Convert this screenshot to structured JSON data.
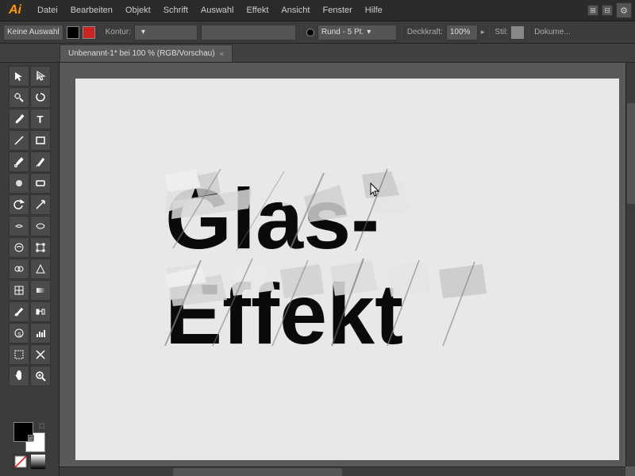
{
  "app": {
    "logo": "Ai",
    "logo_color": "#ff9900"
  },
  "menu": {
    "items": [
      "Datei",
      "Bearbeiten",
      "Objekt",
      "Schrift",
      "Auswahl",
      "Effekt",
      "Ansicht",
      "Fenster",
      "Hilfe"
    ]
  },
  "toolbar": {
    "selection_label": "Keine Auswahl",
    "kontur_label": "Kontur:",
    "stroke_value": "",
    "brush_label": "Rund - 5 Pt.",
    "opacity_label": "Deckkraft:",
    "opacity_value": "100%",
    "style_label": "Stil:",
    "dokument_label": "Dokume..."
  },
  "tab": {
    "title": "Unbenannt-1* bei 100 % (RGB/Vorschau)",
    "close": "×"
  },
  "canvas": {
    "text_line1": "Glas-",
    "text_line2": "Effekt"
  },
  "tools": [
    {
      "name": "selection",
      "icon": "↖",
      "sub": true
    },
    {
      "name": "direct-selection",
      "icon": "↗",
      "sub": false
    },
    {
      "name": "magic-wand",
      "icon": "✦",
      "sub": false
    },
    {
      "name": "lasso",
      "icon": "⌖",
      "sub": false
    },
    {
      "name": "pen",
      "icon": "✒",
      "sub": true
    },
    {
      "name": "type",
      "icon": "T",
      "sub": false
    },
    {
      "name": "line",
      "icon": "╱",
      "sub": false
    },
    {
      "name": "rectangle",
      "icon": "▭",
      "sub": true
    },
    {
      "name": "paintbrush",
      "icon": "🖌",
      "sub": false
    },
    {
      "name": "pencil",
      "icon": "✏",
      "sub": false
    },
    {
      "name": "blob-brush",
      "icon": "⬤",
      "sub": false
    },
    {
      "name": "eraser",
      "icon": "◻",
      "sub": false
    },
    {
      "name": "rotate",
      "icon": "↻",
      "sub": false
    },
    {
      "name": "scale",
      "icon": "⤡",
      "sub": false
    },
    {
      "name": "width",
      "icon": "⟺",
      "sub": false
    },
    {
      "name": "reshape",
      "icon": "⌗",
      "sub": false
    },
    {
      "name": "warp",
      "icon": "⌀",
      "sub": false
    },
    {
      "name": "free-transform",
      "icon": "⊞",
      "sub": false
    },
    {
      "name": "shape-builder",
      "icon": "⊕",
      "sub": false
    },
    {
      "name": "perspective",
      "icon": "⬡",
      "sub": false
    },
    {
      "name": "mesh",
      "icon": "⊠",
      "sub": false
    },
    {
      "name": "gradient",
      "icon": "◑",
      "sub": false
    },
    {
      "name": "eyedropper",
      "icon": "💉",
      "sub": false
    },
    {
      "name": "blend",
      "icon": "⬟",
      "sub": false
    },
    {
      "name": "symbol",
      "icon": "⚙",
      "sub": false
    },
    {
      "name": "column-chart",
      "icon": "▮",
      "sub": false
    },
    {
      "name": "artboard",
      "icon": "⬚",
      "sub": false
    },
    {
      "name": "slice",
      "icon": "✂",
      "sub": false
    },
    {
      "name": "hand",
      "icon": "✋",
      "sub": false
    },
    {
      "name": "zoom",
      "icon": "🔍",
      "sub": false
    }
  ]
}
